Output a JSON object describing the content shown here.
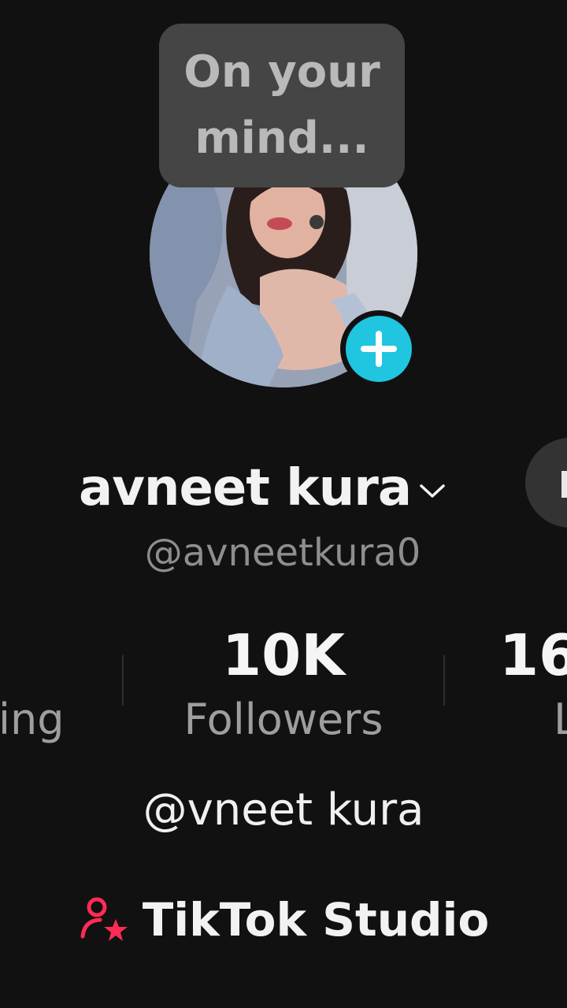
{
  "prompt_bubble": {
    "text": "On your mind..."
  },
  "profile": {
    "display_name": "avneet kura",
    "username": "@avneetkura0",
    "bio": "@vneet kura"
  },
  "stats": {
    "following": {
      "label": "ing"
    },
    "followers": {
      "value": "10K",
      "label": "Followers"
    },
    "likes": {
      "value": "16",
      "label": "L"
    }
  },
  "studio": {
    "label": "TikTok Studio"
  },
  "icons": {
    "avatar_add": "plus-icon",
    "name_menu": "chevron-down-icon",
    "studio": "person-star-icon"
  },
  "colors": {
    "background": "#111111",
    "accent_add": "#20c5e0",
    "studio_icon": "#fe2c55",
    "bubble_bg": "#454545"
  }
}
